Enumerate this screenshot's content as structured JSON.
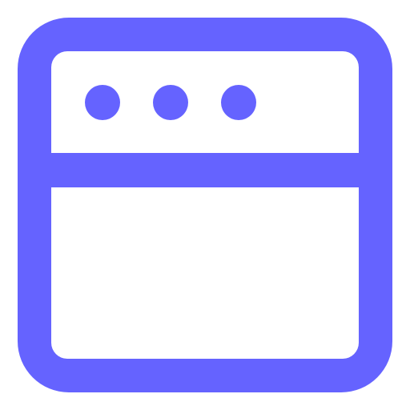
{
  "icon": {
    "name": "browser-window-icon",
    "color": "#6563ff",
    "background": "#ffffff",
    "title_bar_dots": 3
  }
}
